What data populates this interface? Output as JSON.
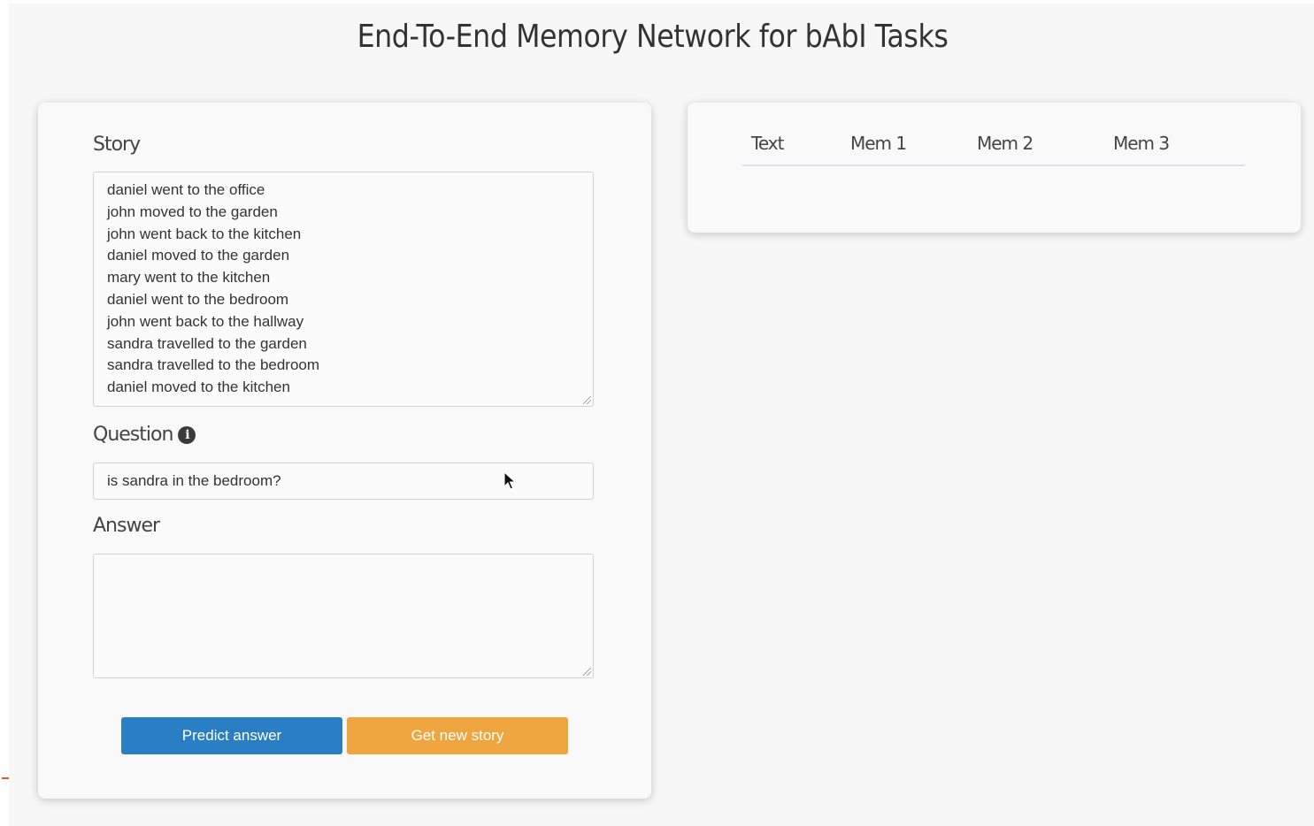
{
  "page": {
    "title": "End-To-End Memory Network for bAbI Tasks"
  },
  "story": {
    "label": "Story",
    "lines": [
      "daniel went to the office",
      "john moved to the garden",
      "john went back to the kitchen",
      "daniel moved to the garden",
      "mary went to the kitchen",
      "daniel went to the bedroom",
      "john went back to the hallway",
      "sandra travelled to the garden",
      "sandra travelled to the bedroom",
      "daniel moved to the kitchen"
    ]
  },
  "question": {
    "label": "Question",
    "info_icon": "info-circle-icon",
    "value": "is sandra in the bedroom?"
  },
  "answer": {
    "label": "Answer",
    "value": ""
  },
  "buttons": {
    "predict_label": "Predict answer",
    "new_story_label": "Get new story"
  },
  "memory_table": {
    "columns": [
      "Text",
      "Mem 1",
      "Mem 2",
      "Mem 3"
    ]
  },
  "colors": {
    "predict_button": "#2a7fc4",
    "new_story_button": "#f0a640",
    "card_background": "#f9f9f9",
    "page_background": "#f7f7f7"
  }
}
